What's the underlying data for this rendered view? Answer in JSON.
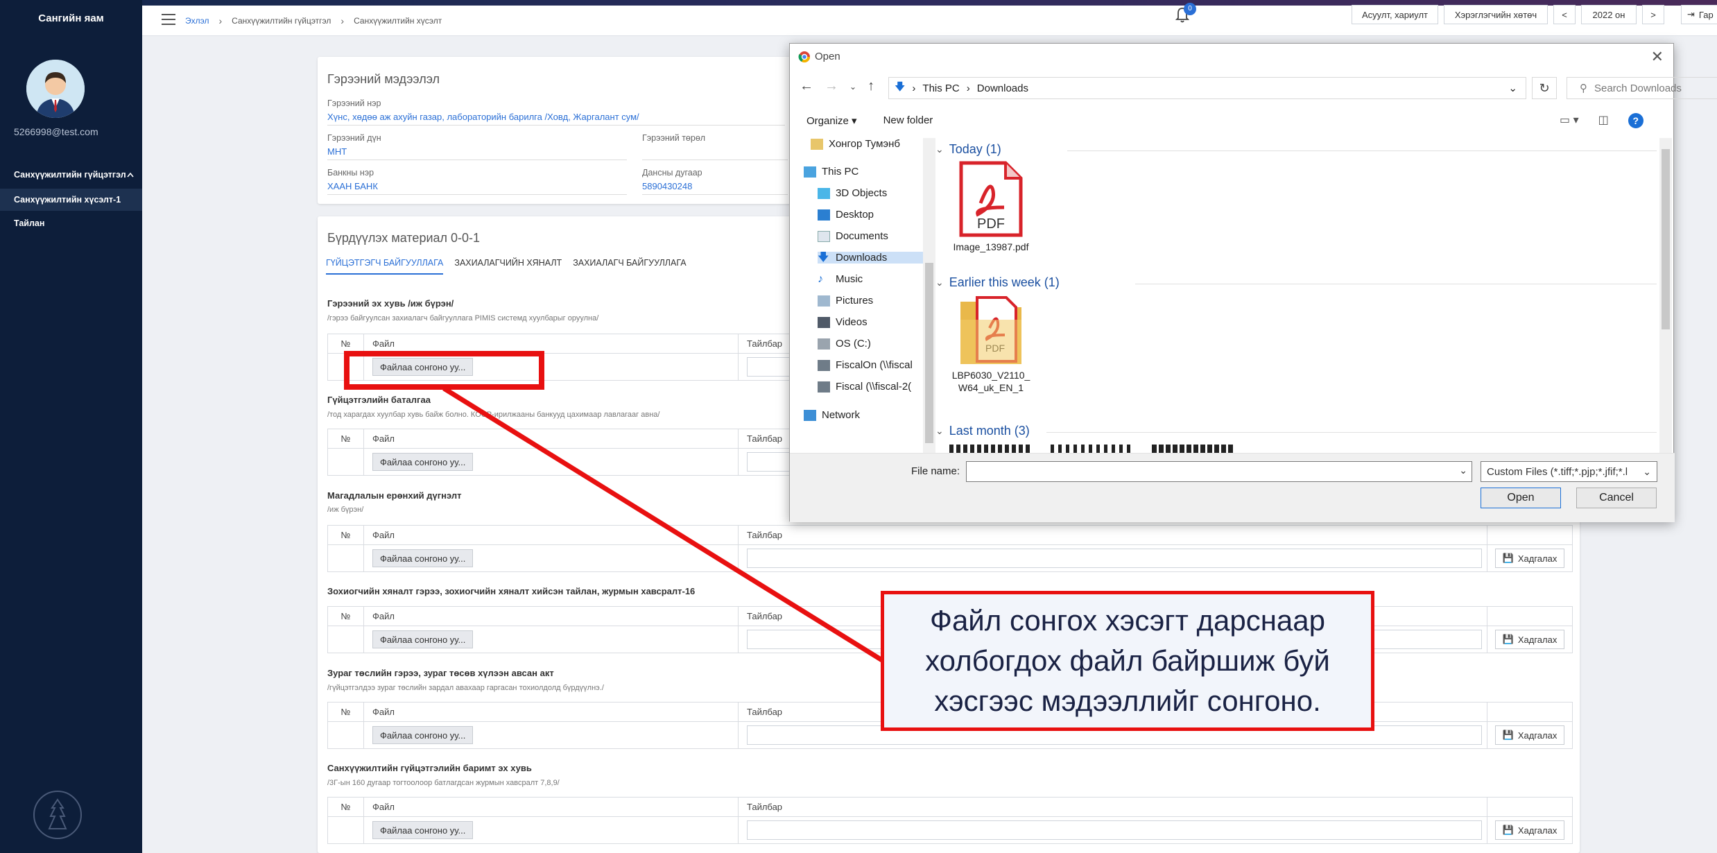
{
  "sidebar": {
    "ministry_name": "Сангийн яам",
    "user_email": "5266998@test.com",
    "group_label": "Санхүүжилтийн гүйцэтгэл",
    "items": [
      {
        "label": "Санхүүжилтийн хүсэлт-1",
        "active": true
      },
      {
        "label": "Тайлан",
        "active": false
      }
    ]
  },
  "header": {
    "breadcrumb": [
      "Эхлэл",
      "Санхүүжилтийн гүйцэтгэл",
      "Санхүүжилтийн хүсэлт"
    ],
    "notification_count": "0",
    "buttons": [
      "Асуулт, хариулт",
      "Хэрэглэгчийн хөтөч",
      "<",
      "2022 он",
      ">",
      "Гар"
    ]
  },
  "contract": {
    "title": "Гэрээний мэдээлэл",
    "name_label": "Гэрээний нэр",
    "name_value": "Хүнс, хөдөө аж ахуйн газар, лабораторийн барилга /Ховд, Жаргалант сум/",
    "amount_label": "Гэрээний дүн",
    "amount_value": "МНТ",
    "type_label": "Гэрээний төрөл",
    "bank_label": "Банкны нэр",
    "bank_value": "ХААН БАНК",
    "account_label": "Дансны дугаар",
    "account_value": "5890430248"
  },
  "materials": {
    "title": "Бүрдүүлэх материал 0-0-1",
    "tabs": [
      "ГҮЙЦЭТГЭГЧ БАЙГУУЛЛАГА",
      "ЗАХИАЛАГЧИЙН ХЯНАЛТ",
      "ЗАХИАЛАГЧ БАЙГУУЛЛАГА"
    ],
    "col_no": "№",
    "col_file": "Файл",
    "col_note": "Тайлбар",
    "choose_label": "Файлаа сонгоно уу...",
    "save_label": "Хадгалах",
    "sections": [
      {
        "title": "Гэрээний эх хувь /иж бүрэн/",
        "subtitle": "/гэрээ байгуулсан захиалагч байгууллага PIMIS системд хуулбарыг оруулна/"
      },
      {
        "title": "Гүйцэтгэлийн баталгаа",
        "subtitle": "/тод харагдах хуулбар хувь байж болно. КОСР-ирилжааны банкууд цахимаар лавлагааг авна/"
      },
      {
        "title": "Магадлалын ерөнхий дүгнэлт",
        "subtitle": "/иж бүрэн/"
      },
      {
        "title": "Зохиогчийн хяналт гэрээ, зохиогчийн хяналт хийсэн тайлан, журмын хавсралт-16",
        "subtitle": ""
      },
      {
        "title": "Зураг төслийн гэрээ, зураг төсөв хүлээн авсан акт",
        "subtitle": "/гүйцэтгэлдээ зураг төслийн зардал авахаар гаргасан тохиолдолд бүрдүүлнэ./"
      },
      {
        "title": "Санхүүжилтийн гүйцэтгэлийн баримт эх хувь",
        "subtitle": "/3Г-ын 160 дугаар тогтоолоор батлагдсан журмын хавсралт 7,8,9/"
      }
    ]
  },
  "dialog": {
    "title": "Open",
    "address": [
      "This PC",
      "Downloads"
    ],
    "search_placeholder": "Search Downloads",
    "toolbar": {
      "organize": "Organize",
      "new_folder": "New folder"
    },
    "nav_items": [
      {
        "label": "Хонгор Тумэнб",
        "icon": "user-folder-icon"
      },
      {
        "label": "This PC",
        "icon": "computer-icon"
      },
      {
        "label": "3D Objects",
        "icon": "cube-icon"
      },
      {
        "label": "Desktop",
        "icon": "desktop-icon"
      },
      {
        "label": "Documents",
        "icon": "documents-icon"
      },
      {
        "label": "Downloads",
        "icon": "download-icon",
        "selected": true
      },
      {
        "label": "Music",
        "icon": "music-icon"
      },
      {
        "label": "Pictures",
        "icon": "pictures-icon"
      },
      {
        "label": "Videos",
        "icon": "videos-icon"
      },
      {
        "label": "OS (C:)",
        "icon": "drive-icon"
      },
      {
        "label": "FiscalOn (\\\\fiscal",
        "icon": "network-drive-icon"
      },
      {
        "label": "Fiscal (\\\\fiscal-2(",
        "icon": "network-drive-icon"
      },
      {
        "label": "Network",
        "icon": "network-icon"
      }
    ],
    "groups": [
      {
        "label": "Today (1)"
      },
      {
        "label": "Earlier this week (1)"
      },
      {
        "label": "Last month (3)"
      }
    ],
    "files": [
      {
        "name": "Image_13987.pdf",
        "kind": "pdf"
      },
      {
        "name": "LBP6030_V2110_W64_uk_EN_1",
        "kind": "folder-pdf"
      }
    ],
    "file_name_label": "File name:",
    "file_type": "Custom Files (*.tiff;*.pjp;*.jfif;*.l",
    "open_label": "Open",
    "cancel_label": "Cancel"
  },
  "annotation": {
    "callout_text": "Файл сонгох хэсэгт дарснаар холбогдох файл байршиж буй хэсгээс мэдээллийг сонгоно.",
    "accent_color": "#e81010"
  }
}
